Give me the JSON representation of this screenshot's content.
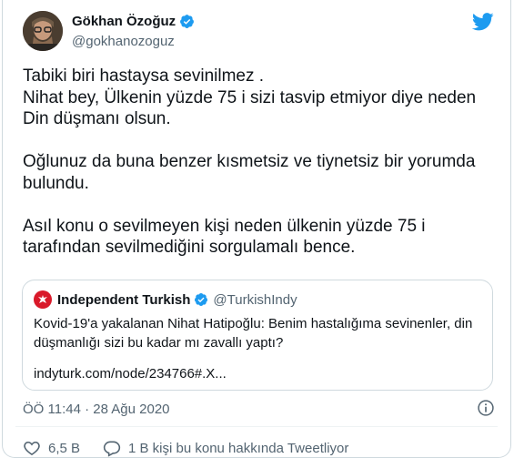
{
  "author": {
    "display_name": "Gökhan Özoğuz",
    "handle": "@gokhanozoguz",
    "verified": true
  },
  "tweet": {
    "lines": [
      "Tabiki biri hastaysa sevinilmez .",
      "Nihat bey, Ülkenin yüzde 75 i sizi tasvip etmiyor diye neden",
      "Din düşmanı olsun.",
      "",
      "Oğlunuz da buna benzer kısmetsiz ve tiynetsiz bir yorumda",
      "bulundu.",
      "",
      "Asıl konu o sevilmeyen kişi neden ülkenin yüzde 75 i",
      "tarafından sevilmediğini sorgulamalı bence."
    ],
    "timestamp": "ÖÖ 11:44 · 28 Ağu 2020"
  },
  "quote": {
    "name": "Independent Turkish",
    "handle": "@TurkishIndy",
    "text_line1": "Kovid-19'a yakalanan Nihat Hatipoğlu: Benim hastalığıma sevinenler, din",
    "text_line2": "düşmanlığı sizi bu kadar mı zavallı yaptı?",
    "link": "indyturk.com/node/234766#.X..."
  },
  "actions": {
    "likes": "6,5 B",
    "reply_label": "1 B kişi bu konu hakkında Tweetliyor"
  },
  "colors": {
    "verified_blue": "#1d9bf0",
    "twitter_blue": "#1d9bf0",
    "independent_red": "#d9192a",
    "secondary_text": "#536471"
  },
  "icons": {
    "brand": "twitter-bird-icon",
    "verified": "verified-badge-icon",
    "info": "info-circle-icon",
    "like": "heart-icon",
    "reply": "speech-bubble-icon",
    "quote_logo": "independent-eagle-icon"
  }
}
